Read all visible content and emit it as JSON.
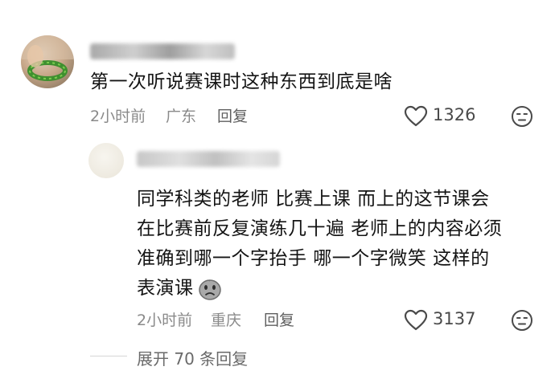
{
  "comments": [
    {
      "text": "第一次听说赛课时这种东西到底是啥",
      "time": "2小时前",
      "location": "广东",
      "reply_label": "回复",
      "likes": "1326"
    },
    {
      "text_lines": [
        "同学科类的老师 比赛上课  而上的这节课会",
        "在比赛前反复演练几十遍  老师上的内容必须",
        "准确到哪一个字抬手 哪一个字微笑   这样的",
        "表演课"
      ],
      "emoji": "sad-face-emoji",
      "time": "2小时前",
      "location": "重庆",
      "reply_label": "回复",
      "likes": "3137"
    }
  ],
  "expand_replies": "展开 70 条回复",
  "colors": {
    "meta": "#8a8a8a",
    "text": "#141414",
    "icon": "#555555"
  }
}
